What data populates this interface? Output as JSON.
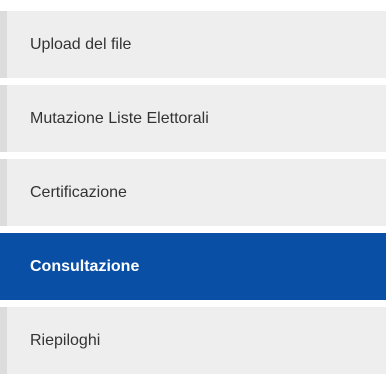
{
  "menu": {
    "items": [
      {
        "label": "Upload del file",
        "active": false
      },
      {
        "label": "Mutazione Liste Elettorali",
        "active": false
      },
      {
        "label": "Certificazione",
        "active": false
      },
      {
        "label": "Consultazione",
        "active": true
      },
      {
        "label": "Riepiloghi",
        "active": false
      }
    ],
    "colors": {
      "item_bg": "#eeeeee",
      "item_border": "#dcdcdc",
      "active_bg": "#0a4fa6",
      "text": "#333333",
      "active_text": "#ffffff"
    }
  }
}
